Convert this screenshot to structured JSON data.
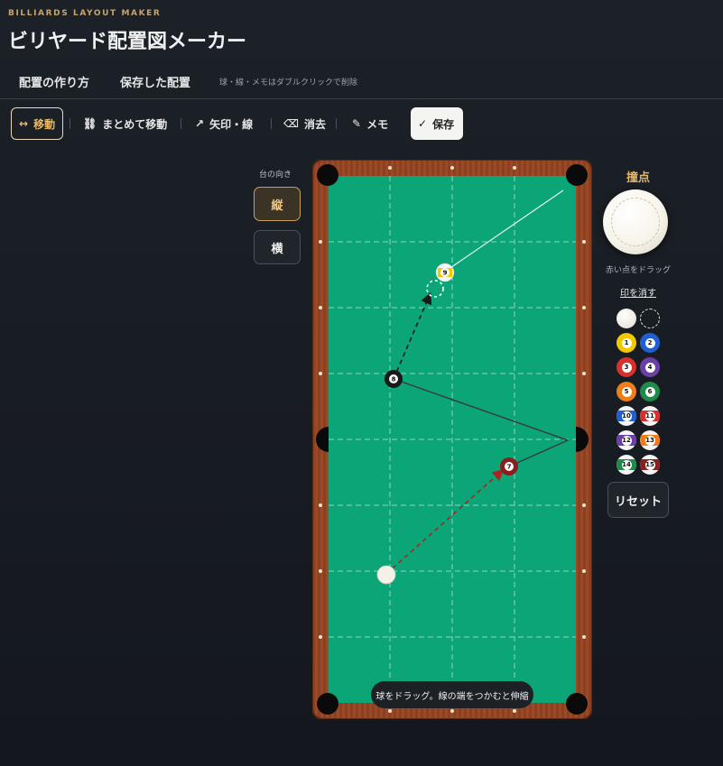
{
  "header": {
    "kicker": "BILLIARDS LAYOUT MAKER",
    "title": "ビリヤード配置図メーカー"
  },
  "tabs": [
    {
      "label": "配置の作り方"
    },
    {
      "label": "保存した配置"
    }
  ],
  "tab_hint": "球・線・メモはダブルクリックで削除",
  "toolbar": {
    "move": {
      "icon": "↔",
      "label": "移動"
    },
    "group_move": {
      "icon": "⛓",
      "label": "まとめて移動"
    },
    "arrow": {
      "icon": "↗",
      "label": "矢印・線"
    },
    "erase": {
      "icon": "⌫",
      "label": "消去"
    },
    "memo": {
      "icon": "✎",
      "label": "メモ"
    },
    "save": {
      "icon": "✓",
      "label": "保存"
    }
  },
  "orientation": {
    "label": "台の向き",
    "vertical": "縦",
    "horizontal": "横",
    "selected": "縦"
  },
  "table": {
    "cloth_color": "#0ba578",
    "rail_color": "#9c4a25",
    "hint": "球をドラッグ。線の端をつかむと伸縮",
    "balls": [
      {
        "number": "9",
        "kind": "stripe",
        "color": "#f2c800"
      },
      {
        "number": "8",
        "kind": "solid",
        "color": "#1a1a1a"
      },
      {
        "number": "7",
        "kind": "solid",
        "color": "#8a1f1f"
      },
      {
        "number": "",
        "kind": "cue",
        "color": "#f4f1e6"
      }
    ]
  },
  "cue_panel": {
    "title": "撞点",
    "hint": "赤い点をドラッグ",
    "clear": "印を消す"
  },
  "tray": [
    {
      "number": "",
      "kind": "cue",
      "color": "#f4f1e6"
    },
    {
      "number": "",
      "kind": "ghost",
      "color": "#ffffff"
    },
    {
      "number": "1",
      "kind": "solid",
      "color": "#f2c800"
    },
    {
      "number": "2",
      "kind": "solid",
      "color": "#1f5fd0"
    },
    {
      "number": "3",
      "kind": "solid",
      "color": "#d8302c"
    },
    {
      "number": "4",
      "kind": "solid",
      "color": "#6b3fa8"
    },
    {
      "number": "5",
      "kind": "solid",
      "color": "#ef7d1a"
    },
    {
      "number": "6",
      "kind": "solid",
      "color": "#1f8a4a"
    },
    {
      "number": "10",
      "kind": "stripe",
      "color": "#1f5fd0"
    },
    {
      "number": "11",
      "kind": "stripe",
      "color": "#d8302c"
    },
    {
      "number": "12",
      "kind": "stripe",
      "color": "#6b3fa8"
    },
    {
      "number": "13",
      "kind": "stripe",
      "color": "#ef7d1a"
    },
    {
      "number": "14",
      "kind": "stripe",
      "color": "#1f8a4a"
    },
    {
      "number": "15",
      "kind": "stripe",
      "color": "#8a1f1f"
    }
  ],
  "reset": "リセット"
}
